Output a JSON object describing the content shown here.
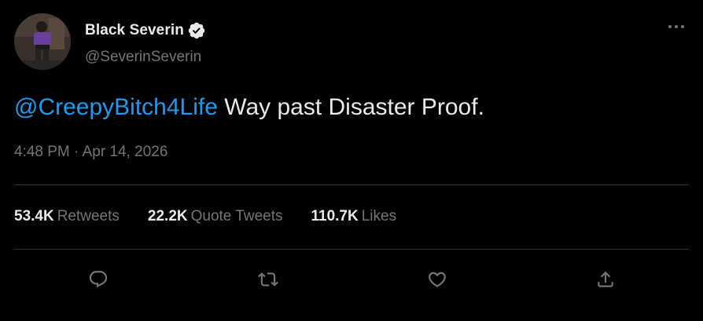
{
  "author": {
    "display_name": "Black Severin",
    "handle": "@SeverinSeverin",
    "verified": true,
    "avatar_icon": "profile-photo"
  },
  "tweet": {
    "mention": "@CreepyBitch4Life",
    "text": " Way past Disaster Proof.",
    "timestamp": "4:48 PM · Apr 14, 2026"
  },
  "stats": [
    {
      "count": "53.4K",
      "label": "Retweets"
    },
    {
      "count": "22.2K",
      "label": "Quote Tweets"
    },
    {
      "count": "110.7K",
      "label": "Likes"
    }
  ],
  "actions": [
    {
      "name": "reply",
      "icon": "reply-icon"
    },
    {
      "name": "retweet",
      "icon": "retweet-icon"
    },
    {
      "name": "like",
      "icon": "heart-icon"
    },
    {
      "name": "share",
      "icon": "share-icon"
    }
  ],
  "colors": {
    "background": "#000000",
    "text": "#e7e9ea",
    "secondary": "#71767b",
    "link": "#1d9bf0",
    "divider": "#2f3336"
  }
}
